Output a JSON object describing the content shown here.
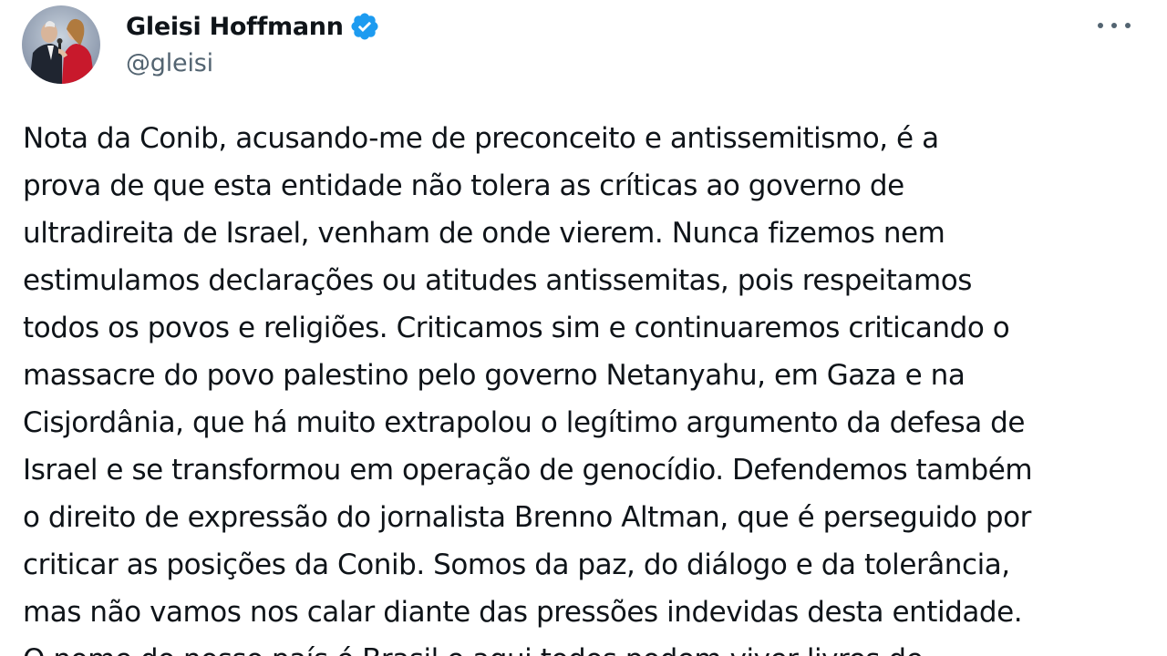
{
  "author": {
    "display_name": "Gleisi Hoffmann",
    "handle": "@gleisi",
    "verified_icon": "verified-badge-icon",
    "verified_color": "#1d9bf0"
  },
  "menu": {
    "icon": "more-options-icon"
  },
  "tweet": {
    "lines": [
      "Nota da Conib, acusando-me de preconceito e antissemitismo, é a",
      "prova de que esta entidade não tolera as críticas ao governo de",
      "ultradireita de Israel, venham de onde vierem. Nunca fizemos nem",
      "estimulamos declarações ou atitudes antissemitas, pois respeitamos",
      "todos os povos e religiões. Criticamos sim e continuaremos criticando o",
      "massacre do povo palestino pelo governo Netanyahu, em Gaza e na",
      "Cisjordânia, que há muito extrapolou o legítimo argumento da defesa de",
      "Israel e se transformou em operação de genocídio. Defendemos também",
      "o direito de expressão do jornalista Brenno Altman, que é perseguido por",
      "criticar as posições da Conib. Somos da paz, do diálogo e da tolerância,",
      "mas não vamos nos calar diante das pressões indevidas desta entidade.",
      "O nome do nosso país é Brasil e aqui todos podem viver livres de"
    ]
  },
  "colors": {
    "text": "#0f1419",
    "secondary": "#536471",
    "background": "#ffffff"
  }
}
